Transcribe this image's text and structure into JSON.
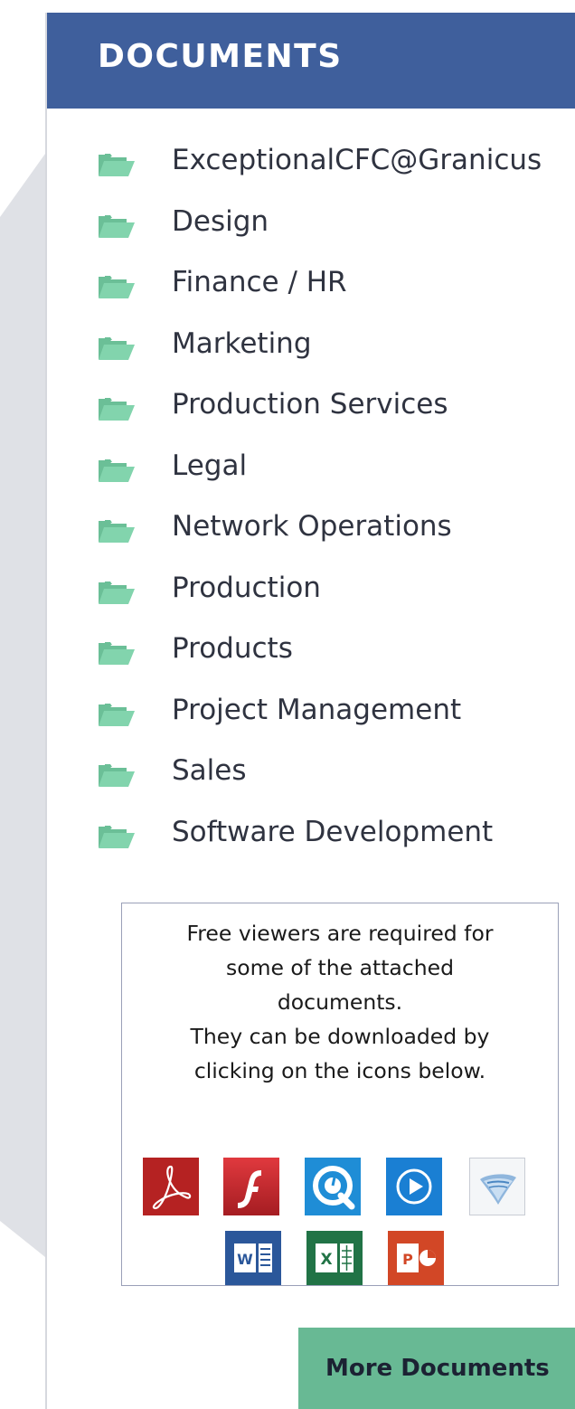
{
  "header": {
    "title": "DOCUMENTS"
  },
  "documents": {
    "items": [
      {
        "label": "ExceptionalCFC@Granicus",
        "icon": "folder-open-icon"
      },
      {
        "label": "Design",
        "icon": "folder-open-icon"
      },
      {
        "label": "Finance / HR",
        "icon": "folder-open-icon"
      },
      {
        "label": "Marketing",
        "icon": "folder-open-icon"
      },
      {
        "label": "Production Services",
        "icon": "folder-open-icon"
      },
      {
        "label": "Legal",
        "icon": "folder-open-icon"
      },
      {
        "label": "Network Operations",
        "icon": "folder-open-icon"
      },
      {
        "label": "Production",
        "icon": "folder-open-icon"
      },
      {
        "label": "Products",
        "icon": "folder-open-icon"
      },
      {
        "label": "Project Management",
        "icon": "folder-open-icon"
      },
      {
        "label": "Sales",
        "icon": "folder-open-icon"
      },
      {
        "label": "Software Development",
        "icon": "folder-open-icon"
      }
    ]
  },
  "viewers": {
    "lines": [
      "Free viewers are required for",
      "some of the attached",
      "documents.",
      "They can be downloaded by",
      "clicking on the icons below."
    ],
    "icons": [
      "adobe-reader-icon",
      "flash-player-icon",
      "quicktime-icon",
      "windows-media-player-icon",
      "silverlight-icon",
      "word-viewer-icon",
      "excel-viewer-icon",
      "powerpoint-viewer-icon"
    ]
  },
  "more_button": {
    "label": "More Documents"
  },
  "colors": {
    "header_bg": "#3f5f9c",
    "folder": "#7fd0a8",
    "button_bg": "#68b994",
    "adobe": "#b52222",
    "flash": "#c4262b",
    "quicktime": "#1f8dd6",
    "wmp": "#1a7fd3",
    "word": "#2b579a",
    "excel": "#217346",
    "powerpoint": "#d24726"
  }
}
